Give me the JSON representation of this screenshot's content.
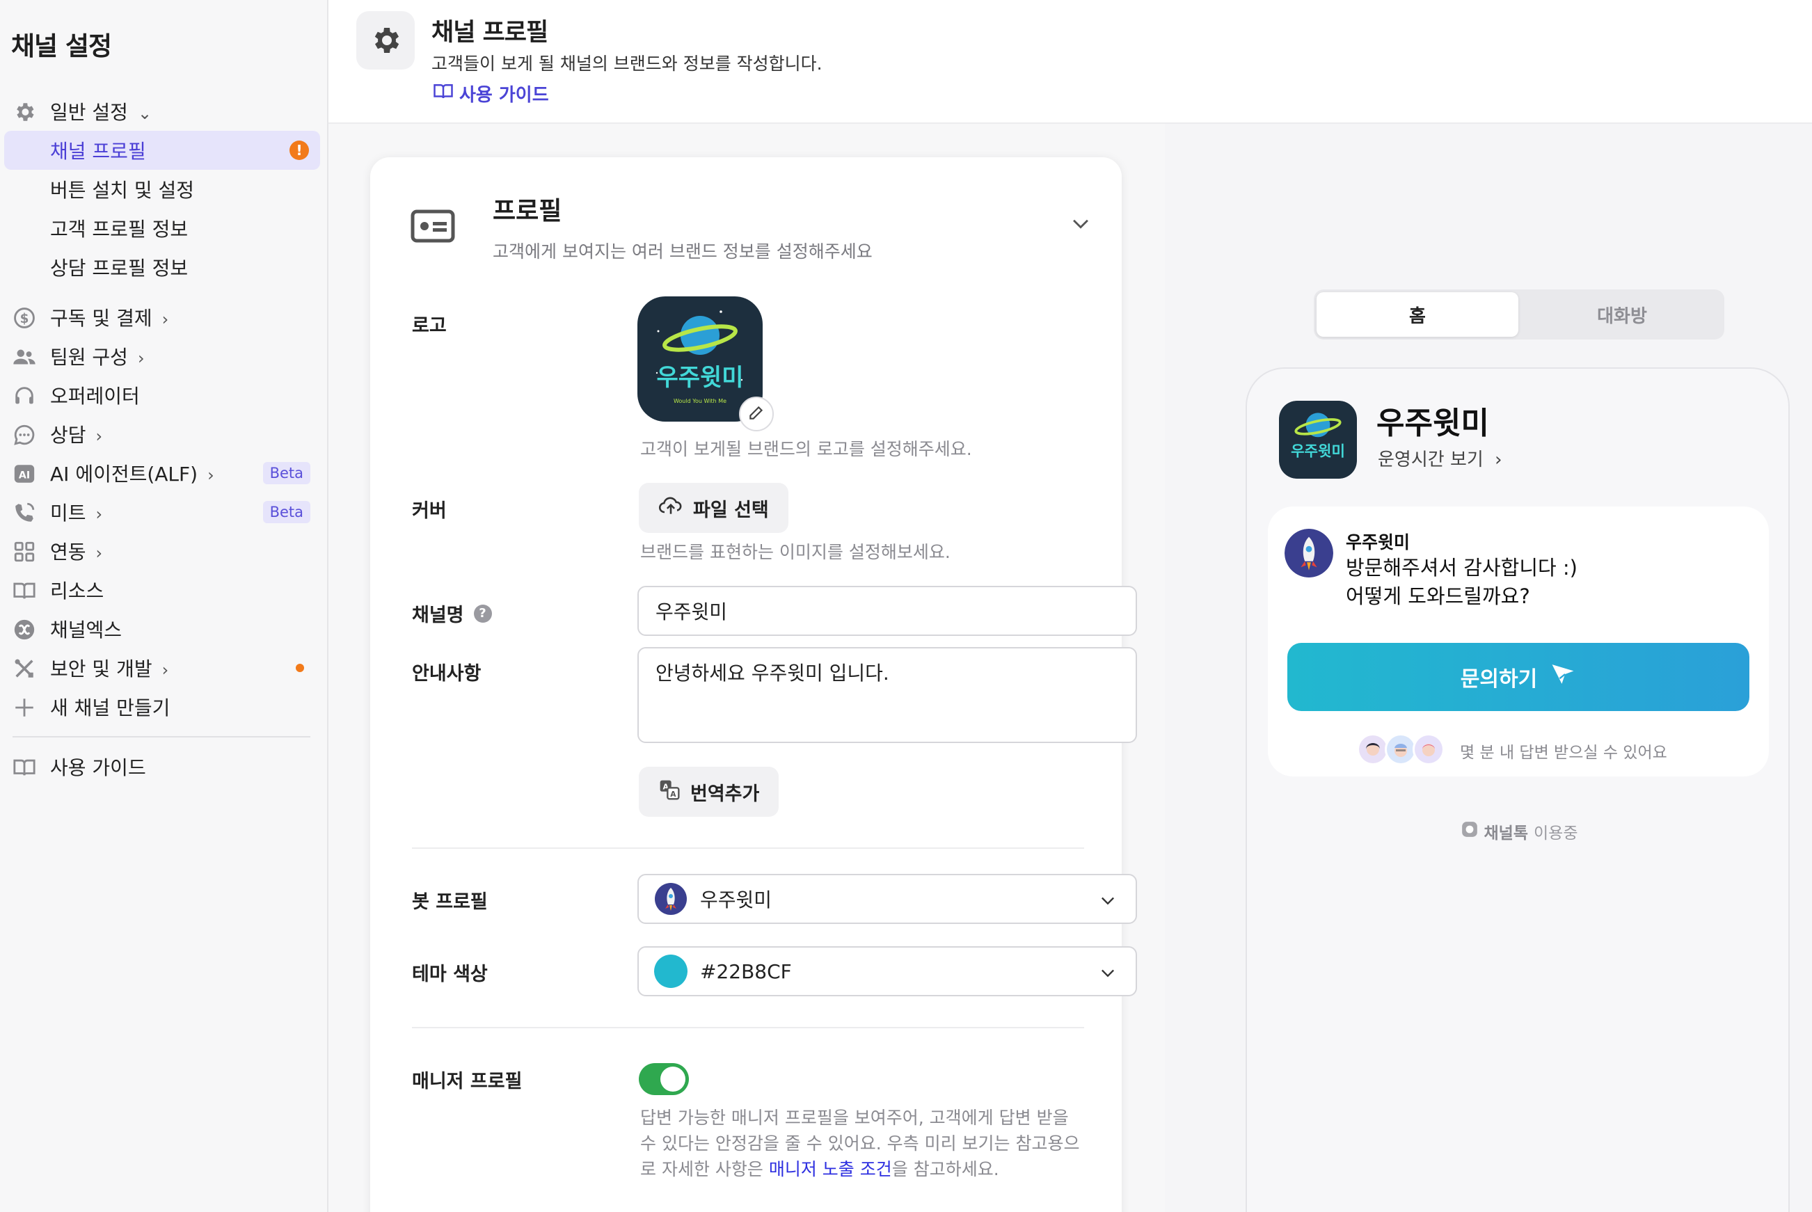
{
  "sidebar": {
    "title": "채널 설정",
    "items": [
      {
        "label": "일반 설정",
        "icon": "gear-icon",
        "chevron": "⌄"
      },
      {
        "label": "채널 프로필",
        "warn": "!"
      },
      {
        "label": "버튼 설치 및 설정"
      },
      {
        "label": "고객 프로필 정보"
      },
      {
        "label": "상담 프로필 정보"
      },
      {
        "label": "구독 및 결제",
        "icon": "dollar-icon",
        "chevron": "›"
      },
      {
        "label": "팀원 구성",
        "icon": "team-icon",
        "chevron": "›"
      },
      {
        "label": "오퍼레이터",
        "icon": "headset-icon"
      },
      {
        "label": "상담",
        "icon": "chat-icon",
        "chevron": "›"
      },
      {
        "label": "AI 에이전트(ALF)",
        "icon": "ai-icon",
        "chevron": "›",
        "badge": "Beta"
      },
      {
        "label": "미트",
        "icon": "phone-icon",
        "chevron": "›",
        "badge": "Beta"
      },
      {
        "label": "연동",
        "icon": "grid-icon",
        "chevron": "›"
      },
      {
        "label": "리소스",
        "icon": "book-icon"
      },
      {
        "label": "채널엑스",
        "icon": "channelx-icon"
      },
      {
        "label": "보안 및 개발",
        "icon": "tools-icon",
        "chevron": "›"
      },
      {
        "label": "새 채널 만들기",
        "icon": "plus-icon"
      },
      {
        "label": "사용 가이드",
        "icon": "book-icon"
      }
    ]
  },
  "header": {
    "title": "채널 프로필",
    "description": "고객들이 보게 될 채널의 브랜드와 정보를 작성합니다.",
    "guide_link": "사용 가이드"
  },
  "profile_card": {
    "title": "프로필",
    "subtitle": "고객에게 보여지는 여러 브랜드 정보를 설정해주세요",
    "logo_label": "로고",
    "logo_help": "고객이 보게될 브랜드의 로고를 설정해주세요.",
    "logo_text": "우주윗미",
    "logo_tagline": "Would You With Me",
    "cover_label": "커버",
    "file_button": "파일 선택",
    "cover_help": "브랜드를 표현하는 이미지를 설정해보세요.",
    "channel_name_label": "채널명",
    "channel_name_value": "우주윗미",
    "notice_label": "안내사항",
    "notice_value": "안녕하세요 우주윗미 입니다.",
    "translate_button": "번역추가",
    "bot_profile_label": "봇 프로필",
    "bot_profile_value": "우주윗미",
    "theme_color_label": "테마 색상",
    "theme_color_value": "#22B8CF",
    "manager_profile_label": "매니저 프로필",
    "manager_profile_on": true,
    "manager_help_1": "답변 가능한 매니저 프로필을 보여주어, 고객에게 답변 받을 수 있다는 안정감을 줄 수 있어요. 우측 미리 보기는 참고용으로 자세한 사항은 ",
    "manager_help_link": "매니저 노출 조건",
    "manager_help_2": "을 참고하세요."
  },
  "preview": {
    "tab_home": "홈",
    "tab_chat": "대화방",
    "channel_name": "우주윗미",
    "hours_link": "운영시간 보기",
    "bot_name": "우주윗미",
    "bot_message": "방문해주셔서 감사합니다 :)\n어떻게 도와드릴까요?",
    "ask_button": "문의하기",
    "reply_time": "몇 분 내 답변 받으실 수 있어요",
    "powered_brand": "채널톡",
    "powered_suffix": "이용중"
  },
  "colors": {
    "accent": "#4b3fd6",
    "theme": "#22B8CF",
    "toggle_on": "#2fa84f",
    "warning": "#f27a1a"
  }
}
